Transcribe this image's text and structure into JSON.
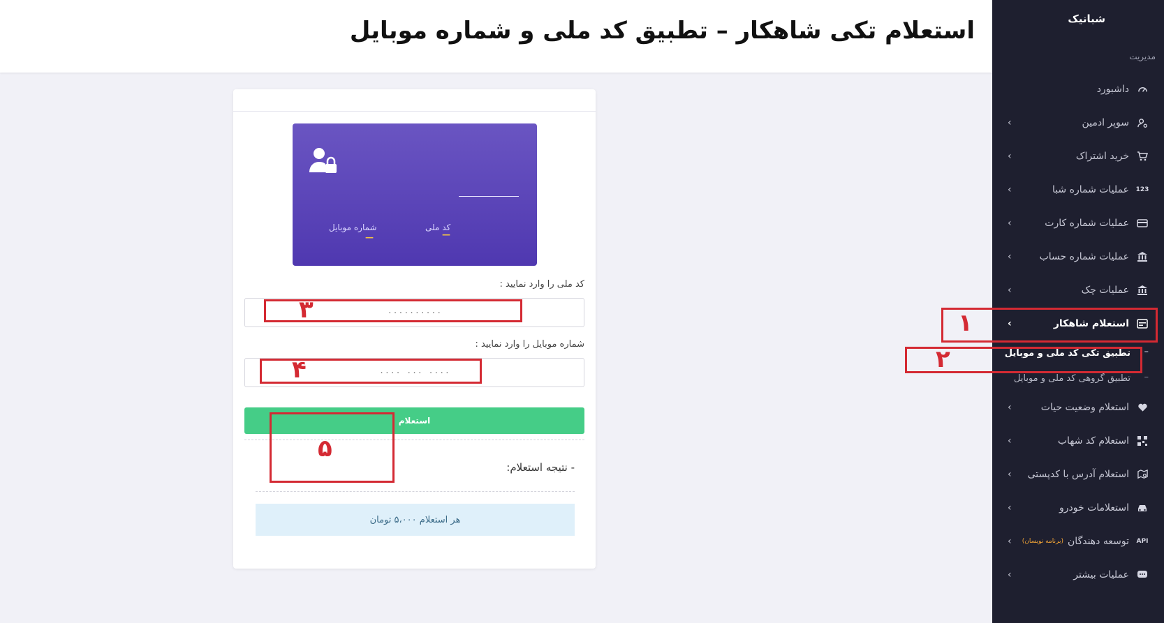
{
  "page": {
    "title": "استعلام تکی شاهکار – تطبیق کد ملی و شماره موبایل"
  },
  "sidebar": {
    "brand": "شبا‌نیک",
    "section_label": "مدیریت",
    "items": [
      {
        "label": "داشبورد",
        "icon": "speedometer-icon",
        "has_chevron": false
      },
      {
        "label": "سوپر ادمین",
        "icon": "user-cog-icon",
        "has_chevron": true
      },
      {
        "label": "خرید اشتراک",
        "icon": "cart-icon",
        "has_chevron": true
      },
      {
        "label": "عملیات شماره شبا",
        "icon": "numbers-icon",
        "icon_text": "123",
        "has_chevron": true
      },
      {
        "label": "عملیات شماره کارت",
        "icon": "credit-card-icon",
        "has_chevron": true
      },
      {
        "label": "عملیات شماره حساب",
        "icon": "bank-icon",
        "has_chevron": true
      },
      {
        "label": "عملیات چک",
        "icon": "bank-icon",
        "has_chevron": true
      },
      {
        "label": "استعلام شاهکار",
        "icon": "id-card-icon",
        "has_chevron": true,
        "active": true
      }
    ],
    "sub_items": [
      {
        "label": "تطبیق تکی کد ملی و موبایل",
        "active": true
      },
      {
        "label": "تطبیق گروهی کد ملی و موبایل",
        "active": false
      }
    ],
    "items_after": [
      {
        "label": "استعلام وضعیت حیات",
        "icon": "heart-icon",
        "has_chevron": true
      },
      {
        "label": "استعلام کد شهاب",
        "icon": "qr-code-icon",
        "has_chevron": true
      },
      {
        "label": "استعلام آدرس با کدپستی",
        "icon": "map-search-icon",
        "has_chevron": true
      },
      {
        "label": "استعلامات خودرو",
        "icon": "car-icon",
        "has_chevron": true
      },
      {
        "label": "توسعه دهندگان",
        "badge": "(برنامه نویسان)",
        "icon": "api-icon",
        "icon_text": "API",
        "has_chevron": true
      },
      {
        "label": "عملیات بیشتر",
        "icon": "chat-dots-icon",
        "has_chevron": true
      }
    ]
  },
  "card": {
    "preview": {
      "national_id_label": "کد ملی",
      "national_id_value": "—",
      "mobile_label": "شماره موبایل",
      "mobile_value": "—"
    },
    "national_id": {
      "label": "کد ملی را وارد نمایید :",
      "placeholder": "۰۰۰۰۰۰۰۰۰۰"
    },
    "mobile": {
      "label": "شماره موبایل را وارد نمایید :",
      "placeholder": "۰۰۰۰ ۰۰۰ ۰۰۰۰"
    },
    "submit_label": "استعلام",
    "result_label": "- نتیجه استعلام:",
    "price_note": "هر استعلام ۵،۰۰۰ تومان"
  },
  "annotations": [
    "۱",
    "۲",
    "۳",
    "۴",
    "۵"
  ],
  "colors": {
    "sidebar_bg": "#1e1f2f",
    "card_gradient_top": "#6a55c2",
    "card_gradient_bottom": "#4f38b0",
    "submit_green": "#45cd87",
    "note_bg": "#dff0fa",
    "annotation_red": "#d42a33"
  }
}
